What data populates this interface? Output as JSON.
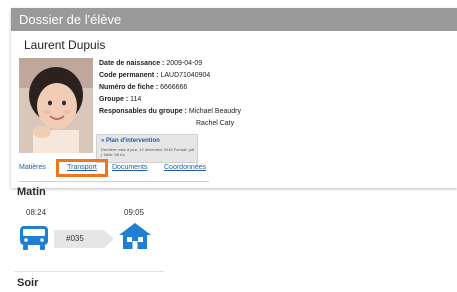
{
  "header": {
    "title": "Dossier de l'élève"
  },
  "student": {
    "name": "Laurent Dupuis",
    "fields": [
      {
        "label": "Date de naissance :",
        "value": " 2009-04-09"
      },
      {
        "label": "Code permanent :",
        "value": " LAUD71040904"
      },
      {
        "label": "Numéro de fiche :",
        "value": " 6666666"
      },
      {
        "label": "Groupe :",
        "value": " 114"
      },
      {
        "label": "Responsables du groupe :",
        "value": " Michael Beaudry"
      }
    ],
    "extra_responsible": "Rachel Caty"
  },
  "plan": {
    "title": "» Plan d'intervention",
    "subtitle": "Dernière mise à jour: 12 décembre 2016 Format: pdf | Taille: 58 Ko"
  },
  "tabs": {
    "materials": "Matières",
    "transport": "Transport",
    "documents": "Documents",
    "contacts": "Coordonnées",
    "active": "Transport"
  },
  "transport": {
    "morning": {
      "title": "Matin",
      "departure_time": "08:24",
      "arrival_time": "09:05",
      "route": "#035",
      "vehicle_icon": "bus-icon",
      "destination_icon": "school-icon"
    },
    "evening": {
      "title": "Soir"
    }
  },
  "colors": {
    "header_bg": "#9a9a9a",
    "link": "#1f5ea8",
    "highlight": "#f0761e",
    "icon_blue": "#1f7fd1"
  }
}
